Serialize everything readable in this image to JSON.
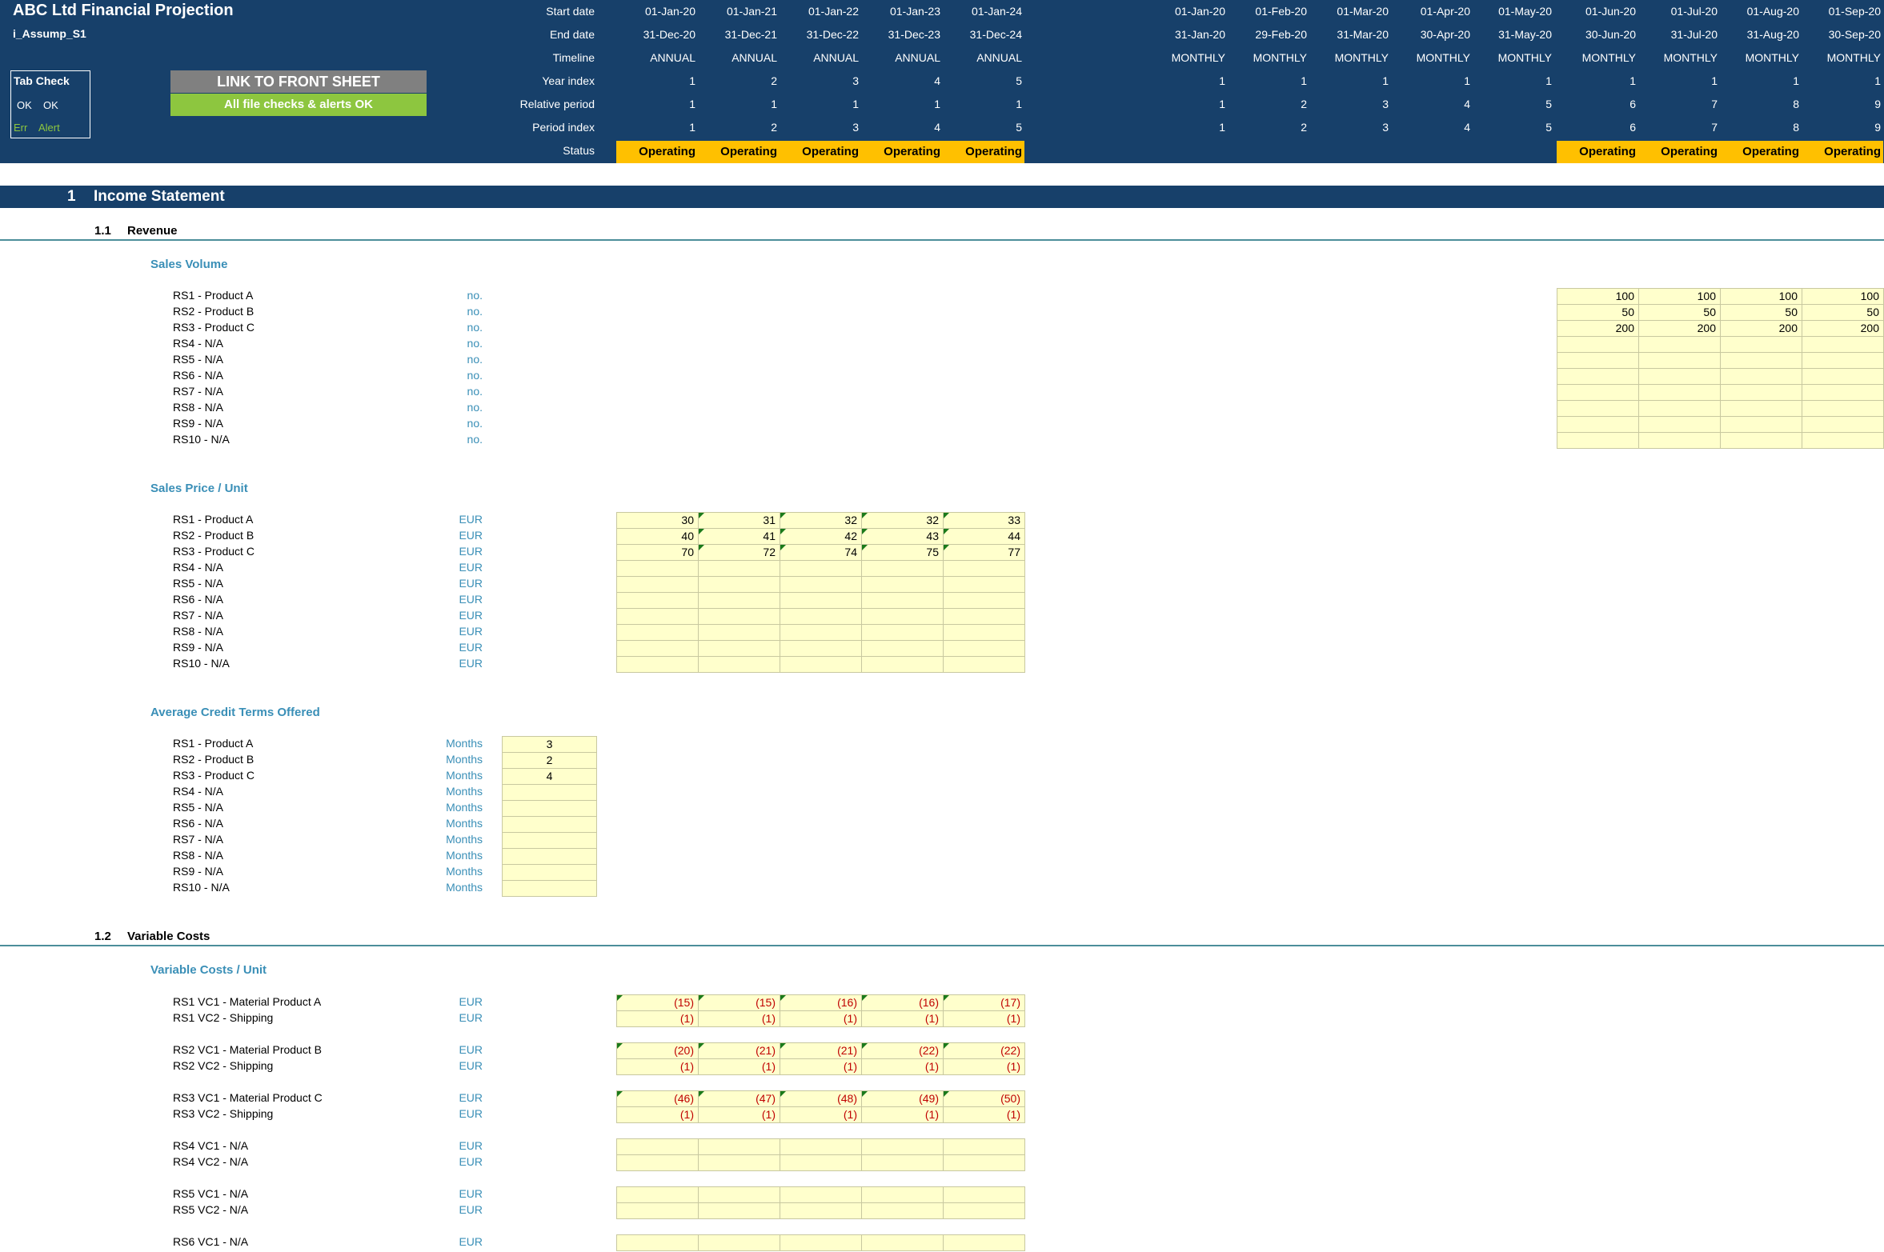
{
  "header": {
    "title": "ABC Ltd Financial Projection",
    "sheet_name": "i_Assump_S1",
    "tab_check": {
      "title": "Tab Check",
      "ok1": "OK",
      "ok2": "OK",
      "err": "Err",
      "alert": "Alert"
    },
    "link_button": "LINK TO FRONT SHEET",
    "checks_status": "All file checks & alerts OK",
    "row_labels": [
      "Start date",
      "End date",
      "Timeline",
      "Year index",
      "Relative period",
      "Period index",
      "Status"
    ],
    "annual": {
      "start": [
        "01-Jan-20",
        "01-Jan-21",
        "01-Jan-22",
        "01-Jan-23",
        "01-Jan-24"
      ],
      "end": [
        "31-Dec-20",
        "31-Dec-21",
        "31-Dec-22",
        "31-Dec-23",
        "31-Dec-24"
      ],
      "timeline": [
        "ANNUAL",
        "ANNUAL",
        "ANNUAL",
        "ANNUAL",
        "ANNUAL"
      ],
      "year_index": [
        "1",
        "2",
        "3",
        "4",
        "5"
      ],
      "relative": [
        "1",
        "1",
        "1",
        "1",
        "1"
      ],
      "period_index": [
        "1",
        "2",
        "3",
        "4",
        "5"
      ],
      "status": [
        "Operating",
        "Operating",
        "Operating",
        "Operating",
        "Operating"
      ]
    },
    "monthly": {
      "start": [
        "01-Jan-20",
        "01-Feb-20",
        "01-Mar-20",
        "01-Apr-20",
        "01-May-20",
        "01-Jun-20",
        "01-Jul-20",
        "01-Aug-20",
        "01-Sep-20"
      ],
      "end": [
        "31-Jan-20",
        "29-Feb-20",
        "31-Mar-20",
        "30-Apr-20",
        "31-May-20",
        "30-Jun-20",
        "31-Jul-20",
        "31-Aug-20",
        "30-Sep-20"
      ],
      "timeline": [
        "MONTHLY",
        "MONTHLY",
        "MONTHLY",
        "MONTHLY",
        "MONTHLY",
        "MONTHLY",
        "MONTHLY",
        "MONTHLY",
        "MONTHLY"
      ],
      "year_index": [
        "1",
        "1",
        "1",
        "1",
        "1",
        "1",
        "1",
        "1",
        "1"
      ],
      "relative": [
        "1",
        "2",
        "3",
        "4",
        "5",
        "6",
        "7",
        "8",
        "9"
      ],
      "period_index": [
        "1",
        "2",
        "3",
        "4",
        "5",
        "6",
        "7",
        "8",
        "9"
      ],
      "status": [
        "",
        "",
        "",
        "",
        "",
        "Operating",
        "Operating",
        "Operating",
        "Operating"
      ]
    }
  },
  "section": {
    "number": "1",
    "title": "Income Statement"
  },
  "revenue": {
    "number": "1.1",
    "title": "Revenue",
    "sales_volume": {
      "title": "Sales Volume",
      "unit": "no.",
      "rows": [
        {
          "label": "RS1 - Product A",
          "values": [
            "100",
            "100",
            "100",
            "100"
          ]
        },
        {
          "label": "RS2 - Product B",
          "values": [
            "50",
            "50",
            "50",
            "50"
          ]
        },
        {
          "label": "RS3 - Product C",
          "values": [
            "200",
            "200",
            "200",
            "200"
          ]
        },
        {
          "label": "RS4 - N/A",
          "values": [
            "",
            "",
            "",
            ""
          ]
        },
        {
          "label": "RS5 - N/A",
          "values": [
            "",
            "",
            "",
            ""
          ]
        },
        {
          "label": "RS6 - N/A",
          "values": [
            "",
            "",
            "",
            ""
          ]
        },
        {
          "label": "RS7 - N/A",
          "values": [
            "",
            "",
            "",
            ""
          ]
        },
        {
          "label": "RS8 - N/A",
          "values": [
            "",
            "",
            "",
            ""
          ]
        },
        {
          "label": "RS9 - N/A",
          "values": [
            "",
            "",
            "",
            ""
          ]
        },
        {
          "label": "RS10 - N/A",
          "values": [
            "",
            "",
            "",
            ""
          ]
        }
      ]
    },
    "sales_price": {
      "title": "Sales Price / Unit",
      "unit": "EUR",
      "rows": [
        {
          "label": "RS1 - Product A",
          "values": [
            "30",
            "31",
            "32",
            "32",
            "33"
          ]
        },
        {
          "label": "RS2 - Product B",
          "values": [
            "40",
            "41",
            "42",
            "43",
            "44"
          ]
        },
        {
          "label": "RS3 - Product C",
          "values": [
            "70",
            "72",
            "74",
            "75",
            "77"
          ]
        },
        {
          "label": "RS4 - N/A",
          "values": [
            "",
            "",
            "",
            "",
            ""
          ]
        },
        {
          "label": "RS5 - N/A",
          "values": [
            "",
            "",
            "",
            "",
            ""
          ]
        },
        {
          "label": "RS6 - N/A",
          "values": [
            "",
            "",
            "",
            "",
            ""
          ]
        },
        {
          "label": "RS7 - N/A",
          "values": [
            "",
            "",
            "",
            "",
            ""
          ]
        },
        {
          "label": "RS8 - N/A",
          "values": [
            "",
            "",
            "",
            "",
            ""
          ]
        },
        {
          "label": "RS9 - N/A",
          "values": [
            "",
            "",
            "",
            "",
            ""
          ]
        },
        {
          "label": "RS10 - N/A",
          "values": [
            "",
            "",
            "",
            "",
            ""
          ]
        }
      ]
    },
    "credit_terms": {
      "title": "Average Credit Terms Offered",
      "unit": "Months",
      "rows": [
        {
          "label": "RS1 - Product A",
          "value": "3"
        },
        {
          "label": "RS2 - Product B",
          "value": "2"
        },
        {
          "label": "RS3 - Product C",
          "value": "4"
        },
        {
          "label": "RS4 - N/A",
          "value": ""
        },
        {
          "label": "RS5 - N/A",
          "value": ""
        },
        {
          "label": "RS6 - N/A",
          "value": ""
        },
        {
          "label": "RS7 - N/A",
          "value": ""
        },
        {
          "label": "RS8 - N/A",
          "value": ""
        },
        {
          "label": "RS9 - N/A",
          "value": ""
        },
        {
          "label": "RS10 - N/A",
          "value": ""
        }
      ]
    }
  },
  "variable_costs": {
    "number": "1.2",
    "title": "Variable Costs",
    "sub_title": "Variable Costs / Unit",
    "unit": "EUR",
    "groups": [
      {
        "rows": [
          {
            "label": "RS1 VC1 - Material Product A",
            "values": [
              "(15)",
              "(15)",
              "(16)",
              "(16)",
              "(17)"
            ]
          },
          {
            "label": "RS1 VC2 - Shipping",
            "values": [
              "(1)",
              "(1)",
              "(1)",
              "(1)",
              "(1)"
            ]
          }
        ]
      },
      {
        "rows": [
          {
            "label": "RS2 VC1 - Material Product B",
            "values": [
              "(20)",
              "(21)",
              "(21)",
              "(22)",
              "(22)"
            ]
          },
          {
            "label": "RS2 VC2 - Shipping",
            "values": [
              "(1)",
              "(1)",
              "(1)",
              "(1)",
              "(1)"
            ]
          }
        ]
      },
      {
        "rows": [
          {
            "label": "RS3 VC1 - Material Product C",
            "values": [
              "(46)",
              "(47)",
              "(48)",
              "(49)",
              "(50)"
            ]
          },
          {
            "label": "RS3 VC2 - Shipping",
            "values": [
              "(1)",
              "(1)",
              "(1)",
              "(1)",
              "(1)"
            ]
          }
        ]
      },
      {
        "rows": [
          {
            "label": "RS4 VC1 - N/A",
            "values": [
              "",
              "",
              "",
              "",
              ""
            ]
          },
          {
            "label": "RS4 VC2 - N/A",
            "values": [
              "",
              "",
              "",
              "",
              ""
            ]
          }
        ]
      },
      {
        "rows": [
          {
            "label": "RS5 VC1 - N/A",
            "values": [
              "",
              "",
              "",
              "",
              ""
            ]
          },
          {
            "label": "RS5 VC2 - N/A",
            "values": [
              "",
              "",
              "",
              "",
              ""
            ]
          }
        ]
      },
      {
        "rows": [
          {
            "label": "RS6 VC1 - N/A",
            "values": [
              "",
              "",
              "",
              "",
              ""
            ]
          }
        ]
      }
    ]
  },
  "colors": {
    "header_bg": "#17406a",
    "status_operating": "#ffc000",
    "input_cell": "#ffffcc",
    "link_button": "#808080",
    "ok_button": "#8dc63f",
    "teal_heading": "#3a8fb7",
    "negative": "#c00000"
  }
}
